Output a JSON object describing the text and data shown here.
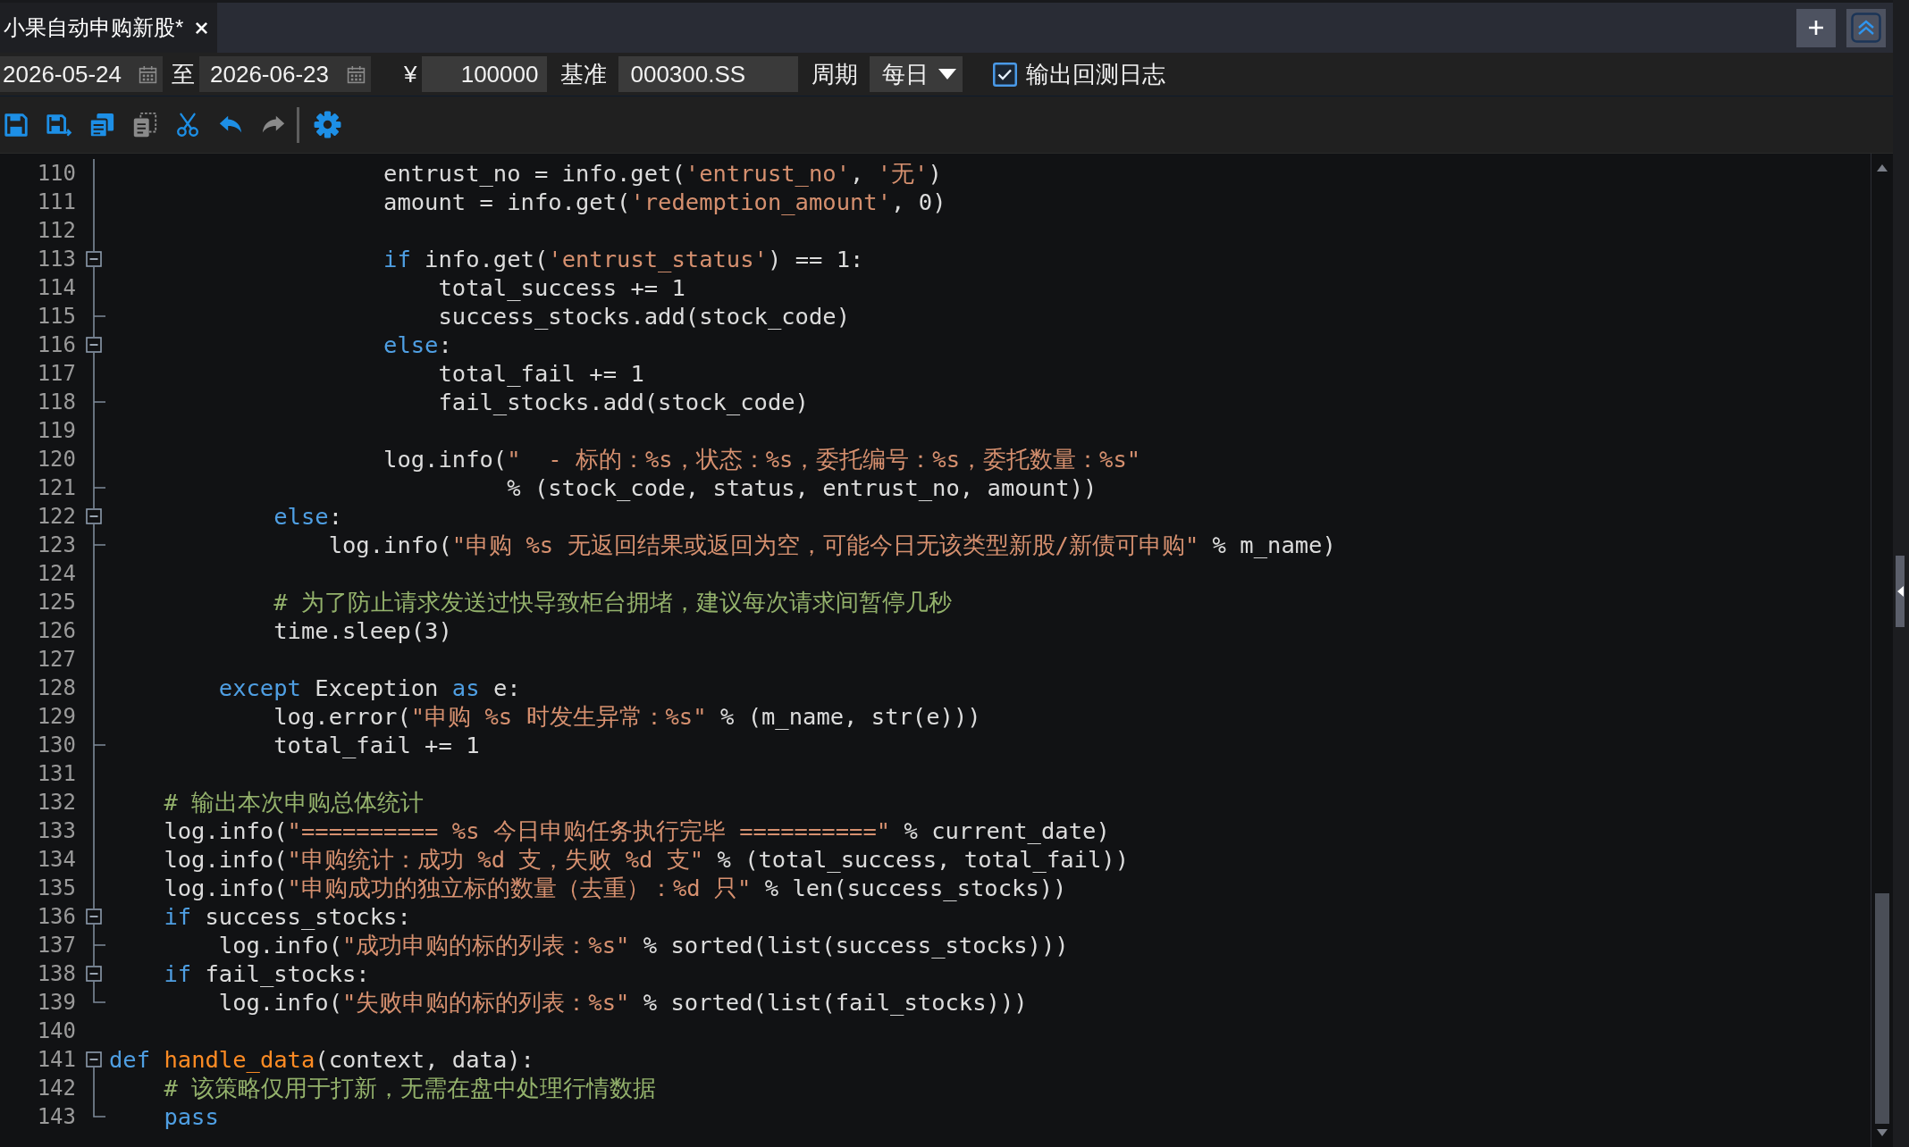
{
  "tabs": [
    {
      "title": "小果自动申购新股*",
      "selected": true
    }
  ],
  "params": {
    "start_date": "2026-05-24",
    "range_label": "至",
    "end_date": "2026-06-23",
    "currency": "¥",
    "capital": "100000",
    "benchmark_label": "基准",
    "benchmark": "000300.SS",
    "period_label": "周期",
    "period": "每日",
    "log_option": {
      "label": "输出回测日志",
      "checked": true
    }
  },
  "toolbar": [
    {
      "buttons": [
        {
          "disabled": false
        },
        {
          "disabled": false
        },
        {
          "disabled": false
        },
        {
          "disabled": true
        },
        {
          "disabled": false
        },
        {
          "disabled": false
        },
        {
          "disabled": true
        }
      ]
    },
    {
      "buttons": [
        {
          "disabled": false
        }
      ]
    }
  ],
  "editor": {
    "lines": [
      {
        "children": [
          {
            "children": [
              {
                "children": [
                  {
                    "children": [
                      {
                        "children": [
                          {
                            "number": "110",
                            "tokens": [
                              {
                                "kind": "plain",
                                "text": "entrust_no = info.get("
                              },
                              {
                                "kind": "string",
                                "text": "'entrust_no'"
                              },
                              {
                                "kind": "plain",
                                "text": ", "
                              },
                              {
                                "kind": "string",
                                "text": "'无'"
                              },
                              {
                                "kind": "plain",
                                "text": ")"
                              }
                            ]
                          },
                          {
                            "number": "111",
                            "tokens": [
                              {
                                "kind": "plain",
                                "text": "amount = info.get("
                              },
                              {
                                "kind": "string",
                                "text": "'redemption_amount'"
                              },
                              {
                                "kind": "plain",
                                "text": ", 0)"
                              }
                            ]
                          },
                          {
                            "number": "112"
                          },
                          {
                            "number": "113",
                            "expanded": true,
                            "tokens": [
                              {
                                "kind": "keyword",
                                "text": "if"
                              },
                              {
                                "kind": "plain",
                                "text": " info.get("
                              },
                              {
                                "kind": "string",
                                "text": "'entrust_status'"
                              },
                              {
                                "kind": "plain",
                                "text": ") == 1:"
                              }
                            ],
                            "children": [
                              {
                                "number": "114",
                                "tokens": [
                                  {
                                    "kind": "plain",
                                    "text": "total_success += 1"
                                  }
                                ]
                              },
                              {
                                "number": "115",
                                "tokens": [
                                  {
                                    "kind": "plain",
                                    "text": "success_stocks.add(stock_code)"
                                  }
                                ]
                              }
                            ]
                          },
                          {
                            "number": "116",
                            "expanded": true,
                            "tokens": [
                              {
                                "kind": "keyword",
                                "text": "else"
                              },
                              {
                                "kind": "plain",
                                "text": ":"
                              }
                            ],
                            "children": [
                              {
                                "number": "117",
                                "tokens": [
                                  {
                                    "kind": "plain",
                                    "text": "total_fail += 1"
                                  }
                                ]
                              },
                              {
                                "number": "118",
                                "tokens": [
                                  {
                                    "kind": "plain",
                                    "text": "fail_stocks.add(stock_code)"
                                  }
                                ]
                              }
                            ]
                          },
                          {
                            "number": "119"
                          },
                          {
                            "number": "120",
                            "tokens": [
                              {
                                "kind": "plain",
                                "text": "log.info("
                              },
                              {
                                "kind": "string",
                                "text": "\"  - 标的：%s，状态：%s，委托编号：%s，委托数量：%s\""
                              }
                            ],
                            "children": [
                              {
                                "number": "121",
                                "kind": "continuation",
                                "tokens": [
                                  {
                                    "kind": "plain",
                                    "text": "% (stock_code, status, entrust_no, amount))"
                                  }
                                ]
                              }
                            ]
                          }
                        ]
                      }
                    ]
                  },
                  {
                    "number": "122",
                    "expanded": true,
                    "tokens": [
                      {
                        "kind": "keyword",
                        "text": "else"
                      },
                      {
                        "kind": "plain",
                        "text": ":"
                      }
                    ],
                    "children": [
                      {
                        "number": "123",
                        "tokens": [
                          {
                            "kind": "plain",
                            "text": "log.info("
                          },
                          {
                            "kind": "string",
                            "text": "\"申购 %s 无返回结果或返回为空，可能今日无该类型新股/新债可申购\""
                          },
                          {
                            "kind": "plain",
                            "text": " % m_name)"
                          }
                        ]
                      }
                    ]
                  },
                  {
                    "number": "124"
                  },
                  {
                    "number": "125",
                    "tokens": [
                      {
                        "kind": "comment",
                        "text": "# 为了防止请求发送过快导致柜台拥堵，建议每次请求间暂停几秒"
                      }
                    ]
                  },
                  {
                    "number": "126",
                    "tokens": [
                      {
                        "kind": "plain",
                        "text": "time.sleep(3)"
                      }
                    ]
                  },
                  {
                    "number": "127"
                  }
                ]
              },
              {
                "number": "128",
                "tokens": [
                  {
                    "kind": "keyword",
                    "text": "except"
                  },
                  {
                    "kind": "plain",
                    "text": " Exception "
                  },
                  {
                    "kind": "keyword",
                    "text": "as"
                  },
                  {
                    "kind": "plain",
                    "text": " e:"
                  }
                ],
                "children": [
                  {
                    "number": "129",
                    "tokens": [
                      {
                        "kind": "plain",
                        "text": "log.error("
                      },
                      {
                        "kind": "string",
                        "text": "\"申购 %s 时发生异常：%s\""
                      },
                      {
                        "kind": "plain",
                        "text": " % (m_name, str(e)))"
                      }
                    ]
                  },
                  {
                    "number": "130",
                    "tokens": [
                      {
                        "kind": "plain",
                        "text": "total_fail += 1"
                      }
                    ]
                  }
                ]
              },
              {
                "number": "131"
              }
            ]
          },
          {
            "number": "132",
            "tokens": [
              {
                "kind": "comment",
                "text": "# 输出本次申购总体统计"
              }
            ]
          },
          {
            "number": "133",
            "tokens": [
              {
                "kind": "plain",
                "text": "log.info("
              },
              {
                "kind": "string",
                "text": "\"========== %s 今日申购任务执行完毕 ==========\""
              },
              {
                "kind": "plain",
                "text": " % current_date)"
              }
            ]
          },
          {
            "number": "134",
            "tokens": [
              {
                "kind": "plain",
                "text": "log.info("
              },
              {
                "kind": "string",
                "text": "\"申购统计：成功 %d 支，失败 %d 支\""
              },
              {
                "kind": "plain",
                "text": " % (total_success, total_fail))"
              }
            ]
          },
          {
            "number": "135",
            "tokens": [
              {
                "kind": "plain",
                "text": "log.info("
              },
              {
                "kind": "string",
                "text": "\"申购成功的独立标的数量（去重）：%d 只\""
              },
              {
                "kind": "plain",
                "text": " % len(success_stocks))"
              }
            ]
          },
          {
            "number": "136",
            "expanded": true,
            "tokens": [
              {
                "kind": "keyword",
                "text": "if"
              },
              {
                "kind": "plain",
                "text": " success_stocks:"
              }
            ],
            "children": [
              {
                "number": "137",
                "tokens": [
                  {
                    "kind": "plain",
                    "text": "log.info("
                  },
                  {
                    "kind": "string",
                    "text": "\"成功申购的标的列表：%s\""
                  },
                  {
                    "kind": "plain",
                    "text": " % sorted(list(success_stocks)))"
                  }
                ]
              }
            ]
          },
          {
            "number": "138",
            "expanded": true,
            "tokens": [
              {
                "kind": "keyword",
                "text": "if"
              },
              {
                "kind": "plain",
                "text": " fail_stocks:"
              }
            ],
            "children": [
              {
                "number": "139",
                "tokens": [
                  {
                    "kind": "plain",
                    "text": "log.info("
                  },
                  {
                    "kind": "string",
                    "text": "\"失败申购的标的列表：%s\""
                  },
                  {
                    "kind": "plain",
                    "text": " % sorted(list(fail_stocks)))"
                  }
                ]
              }
            ]
          }
        ]
      },
      {
        "number": "140"
      },
      {
        "number": "141",
        "expanded": true,
        "tokens": [
          {
            "kind": "keyword",
            "text": "def "
          },
          {
            "kind": "function",
            "text": "handle_data"
          },
          {
            "kind": "plain",
            "text": "(context, data):"
          }
        ],
        "children": [
          {
            "number": "142",
            "tokens": [
              {
                "kind": "comment",
                "text": "# 该策略仅用于打新，无需在盘中处理行情数据"
              }
            ]
          },
          {
            "number": "143",
            "tokens": [
              {
                "kind": "keyword",
                "text": "pass"
              }
            ]
          }
        ]
      }
    ]
  }
}
